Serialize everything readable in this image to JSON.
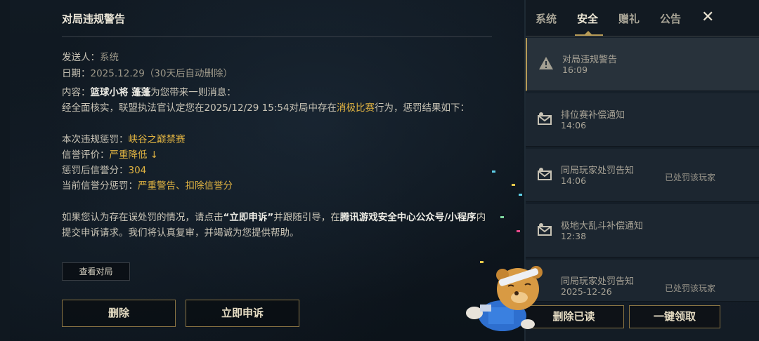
{
  "dialog": {
    "title": "对局违规警告",
    "sender_label": "发送人：",
    "sender_value": "系统",
    "date_label": "日期：",
    "date_value": "2025.12.29（30天后自动删除）",
    "content_label": "内容：",
    "content_name": "篮球小将 蓬蓬",
    "content_tail": "为您带来一则消息：",
    "line2_pre": "经全面核实，联盟执法官认定您在2025/12/29 15:54对局中存在",
    "line2_gold": "消极比赛",
    "line2_post": "行为，惩罚结果如下：",
    "penalty_label": "本次违规惩罚：",
    "penalty_value": "峡谷之巅禁赛",
    "credit_label": "信誉评价：",
    "credit_value": "严重降低",
    "credit_arrow": "↓",
    "score_label": "惩罚后信誉分：",
    "score_value": "304",
    "current_label": "当前信誉分惩罚：",
    "current_value": "严重警告、扣除信誉分",
    "appeal_pre": "如果您认为存在误处罚的情况，请点击",
    "appeal_btn_quote": "“立即申诉”",
    "appeal_mid": "并跟随引导，在",
    "appeal_channel": "腾讯游戏安全中心公众号/小程序",
    "appeal_post": "内",
    "appeal_line2": "提交申诉请求。我们将认真复审，并竭诚为您提供帮助。",
    "view_match": "查看对局",
    "delete": "删除",
    "appeal_now": "立即申诉"
  },
  "tabs": [
    "系统",
    "安全",
    "赠礼",
    "公告"
  ],
  "active_tab": "安全",
  "close_icon": "close-icon",
  "mails": [
    {
      "title": "对局违规警告",
      "time": "16:09",
      "note": "",
      "icon": "warning-icon"
    },
    {
      "title": "排位赛补偿通知",
      "time": "14:06",
      "note": "",
      "icon": "mail-icon"
    },
    {
      "title": "同局玩家处罚告知",
      "time": "14:06",
      "note": "已处罚该玩家",
      "icon": "mail-icon"
    },
    {
      "title": "极地大乱斗补偿通知",
      "time": "12:38",
      "note": "",
      "icon": "mail-icon"
    },
    {
      "title": "同局玩家处罚告知",
      "time": "2025-12-26",
      "note": "已处罚该玩家",
      "icon": "mail-icon"
    }
  ],
  "footer": {
    "delete_read": "删除已读",
    "claim_all": "一键领取"
  },
  "colors": {
    "gold": "#e0b342",
    "border_gold": "#8a7443",
    "bg": "#0c141c"
  }
}
